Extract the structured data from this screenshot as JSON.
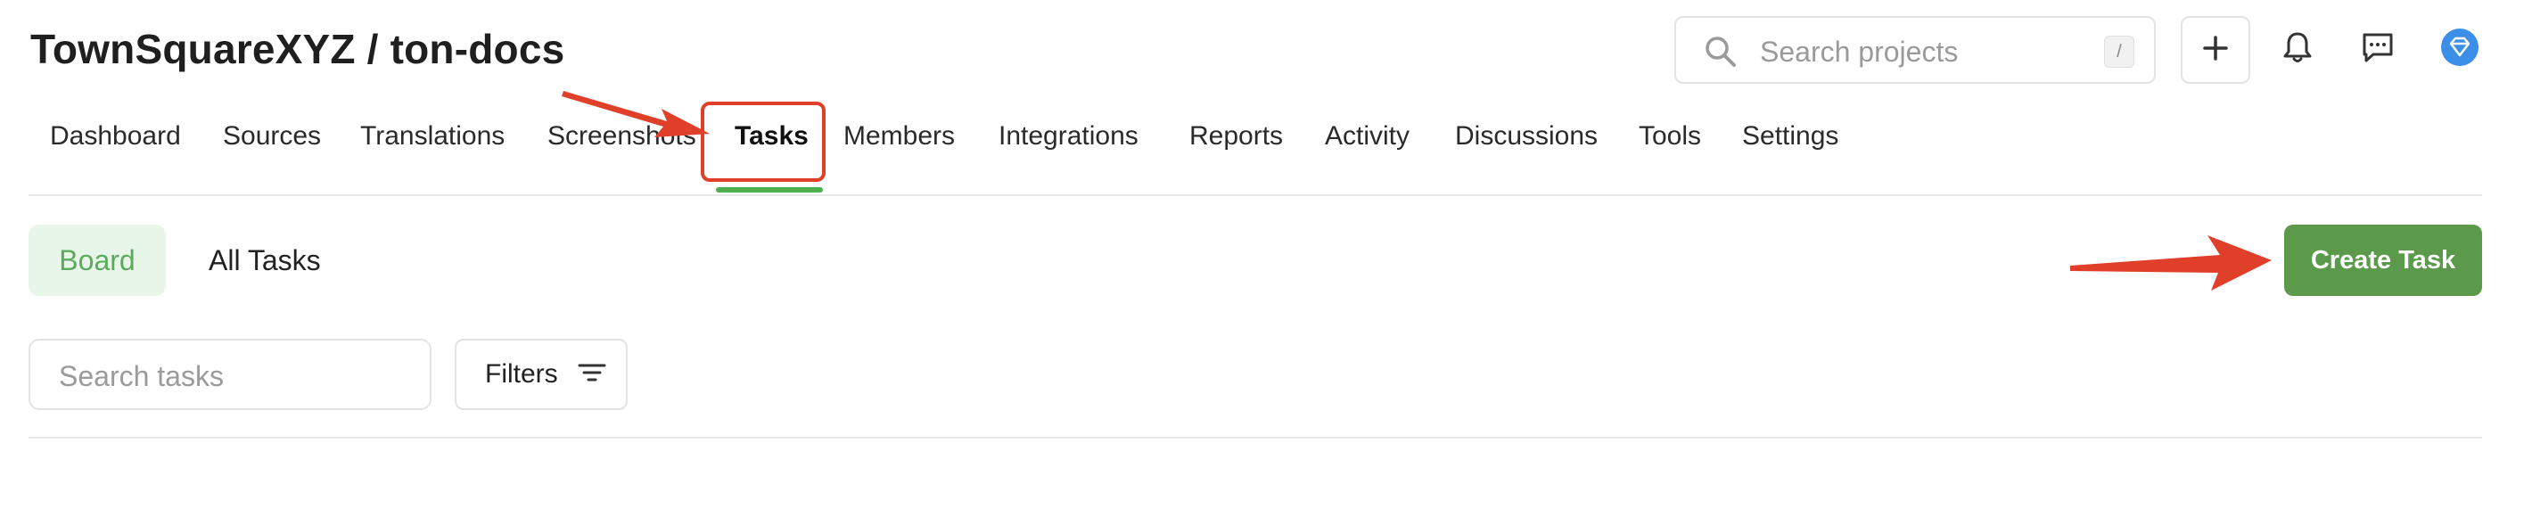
{
  "header": {
    "title": "TownSquareXYZ / ton-docs",
    "search_placeholder": "Search projects",
    "search_shortcut": "/"
  },
  "nav": {
    "tabs": [
      {
        "label": "Dashboard"
      },
      {
        "label": "Sources"
      },
      {
        "label": "Translations"
      },
      {
        "label": "Screenshots"
      },
      {
        "label": "Tasks",
        "active": true
      },
      {
        "label": "Members"
      },
      {
        "label": "Integrations"
      },
      {
        "label": "Reports"
      },
      {
        "label": "Activity"
      },
      {
        "label": "Discussions"
      },
      {
        "label": "Tools"
      },
      {
        "label": "Settings"
      }
    ]
  },
  "view": {
    "board_label": "Board",
    "all_tasks_label": "All Tasks",
    "create_task_label": "Create Task"
  },
  "filters": {
    "search_placeholder": "Search tasks",
    "filters_label": "Filters"
  },
  "icons": {
    "search": "search-icon",
    "plus": "plus-icon",
    "bell": "bell-icon",
    "chat": "chat-icon",
    "avatar": "diamond-avatar-icon",
    "filter": "filter-lines-icon"
  },
  "colors": {
    "accent_green": "#5a9a4a",
    "active_underline": "#4caf50",
    "board_bg": "#e8f5e9",
    "annotation_red": "#e0402a",
    "avatar_blue": "#3b8fe6"
  }
}
